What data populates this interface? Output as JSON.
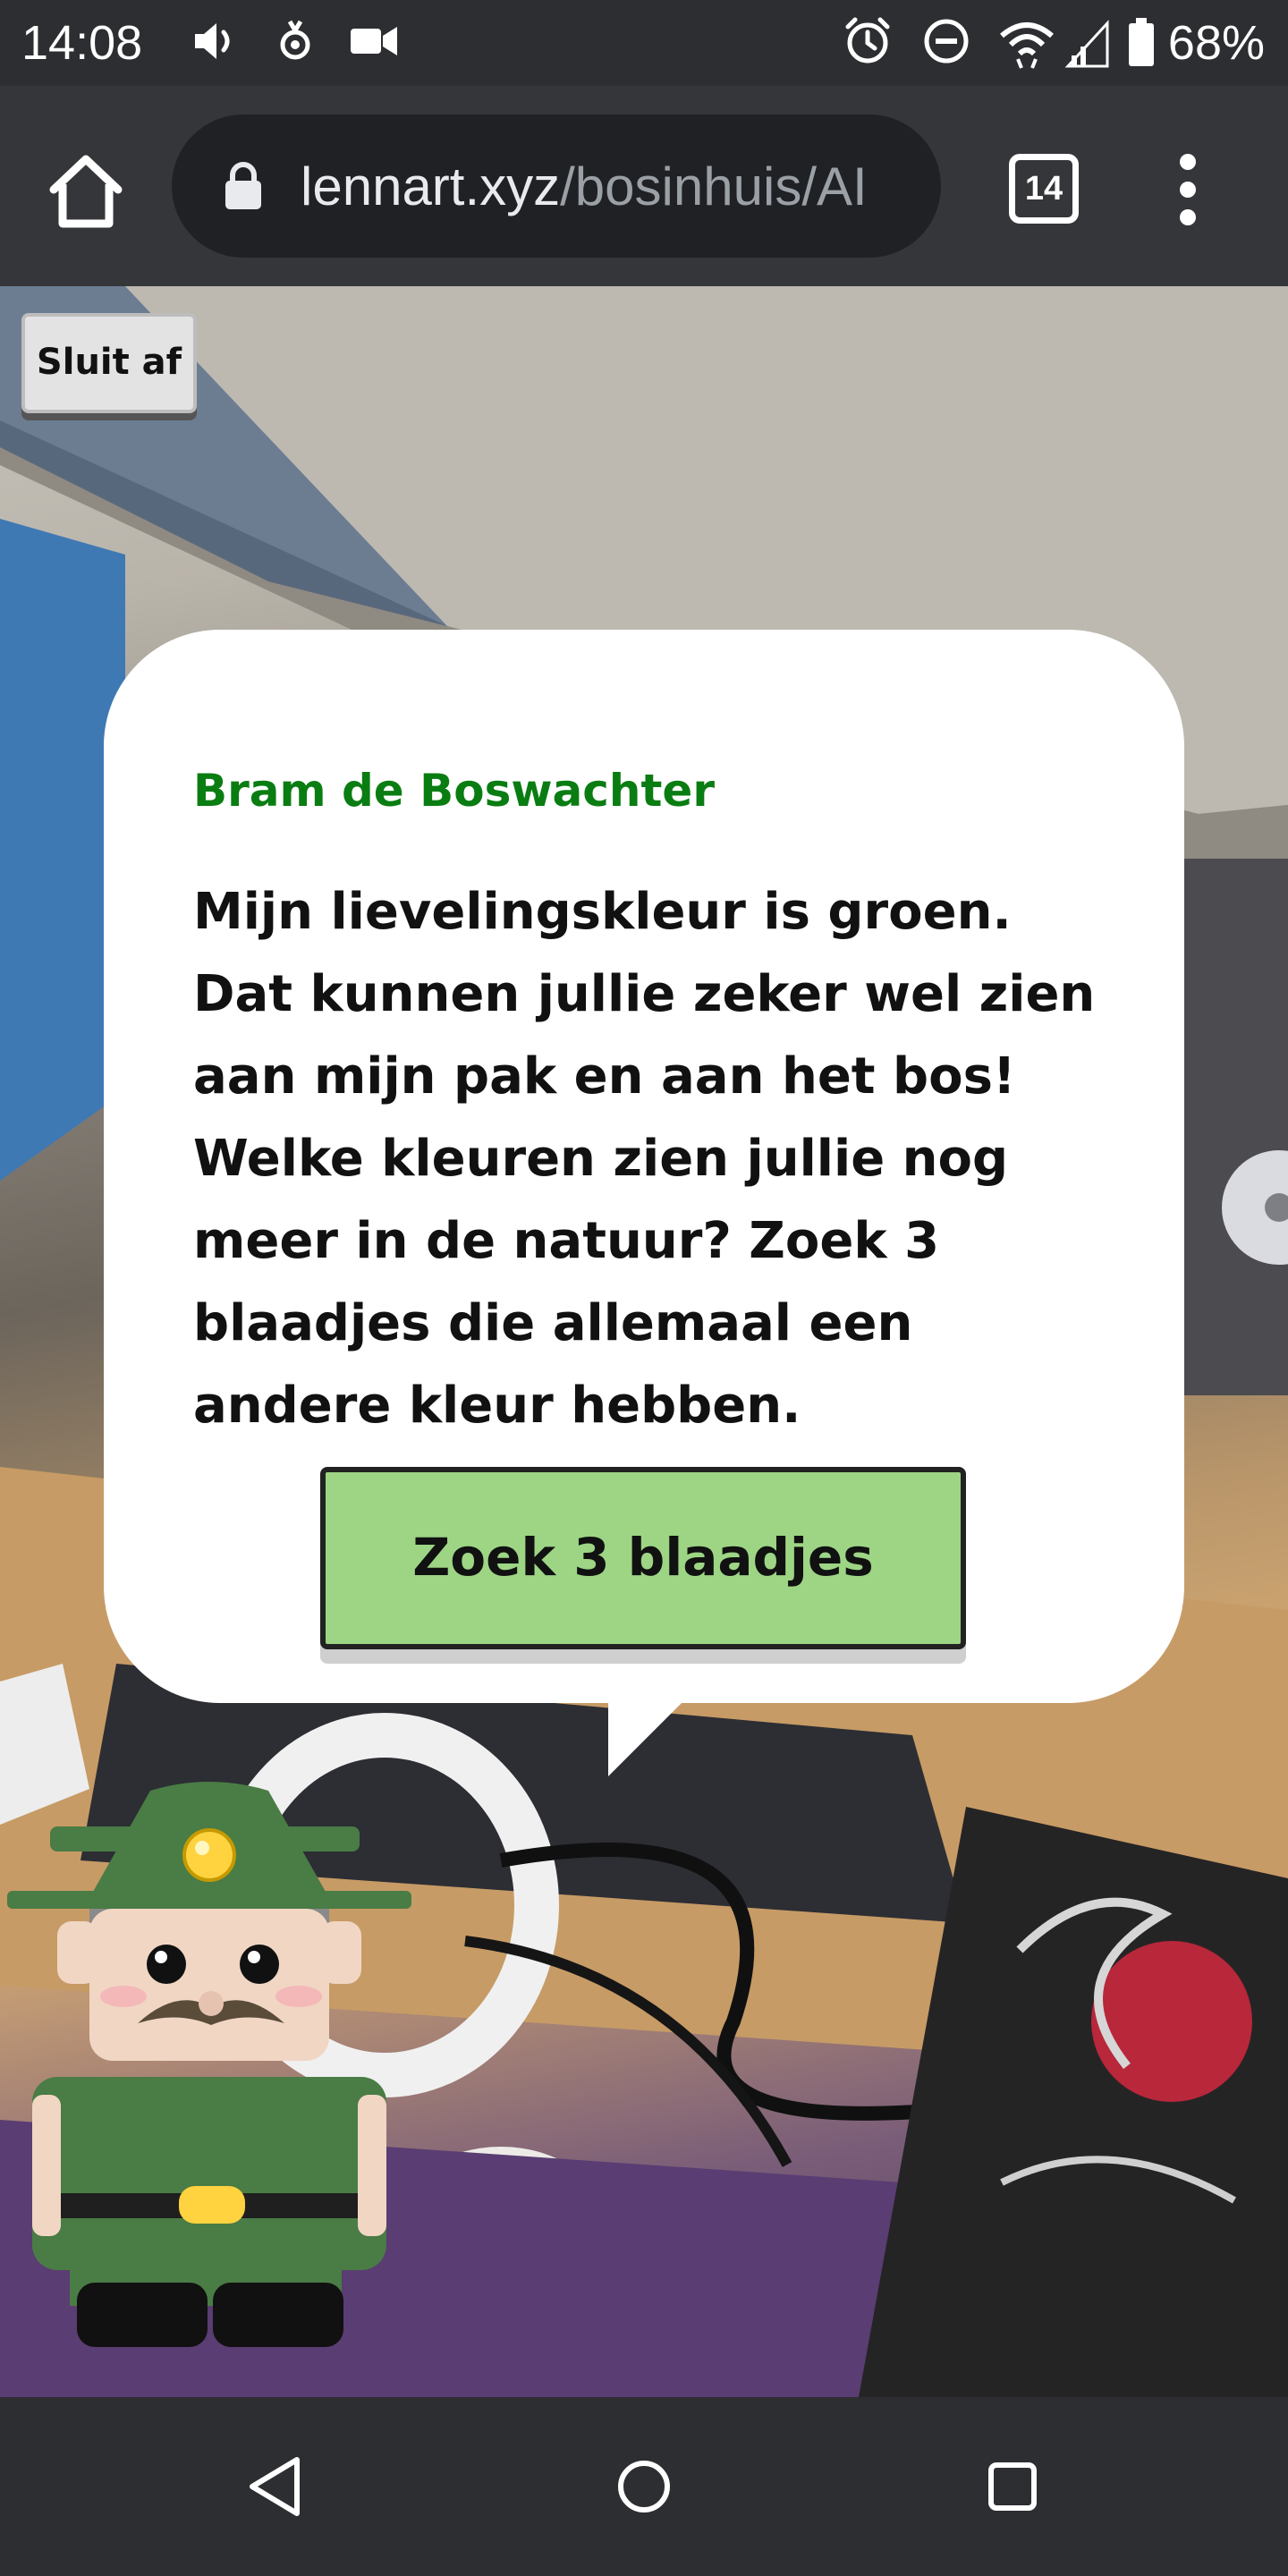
{
  "status_bar": {
    "time": "14:08",
    "battery_percent": "68%",
    "icons": [
      "volume-icon",
      "accessibility-icon",
      "video-call-icon",
      "alarm-icon",
      "do-not-disturb-icon",
      "wifi-icon",
      "signal-icon",
      "battery-icon"
    ]
  },
  "browser": {
    "url_domain": "lennart.xyz",
    "url_path": "/bosinhuis/AI",
    "tab_count": "14",
    "icons": [
      "home-icon",
      "lock-icon",
      "tabs-icon",
      "menu-icon"
    ]
  },
  "page": {
    "close_label": "Sluit af",
    "speaker": "Bram de Boswachter",
    "message": "Mijn lievelingskleur is groen. Dat kunnen jullie zeker wel zien aan mijn pak en aan het bos! Welke kleuren zien jullie nog meer in de natuur? Zoek 3 blaadjes die allemaal een andere kleur hebben.",
    "action_label": "Zoek 3 blaadjes",
    "colors": {
      "speaker_name": "#0a7d12",
      "action_button": "#9dd585",
      "ranger_uniform": "#4a7c45"
    }
  },
  "nav_bar": {
    "icons": [
      "back-icon",
      "home-circle-icon",
      "recents-icon"
    ]
  }
}
